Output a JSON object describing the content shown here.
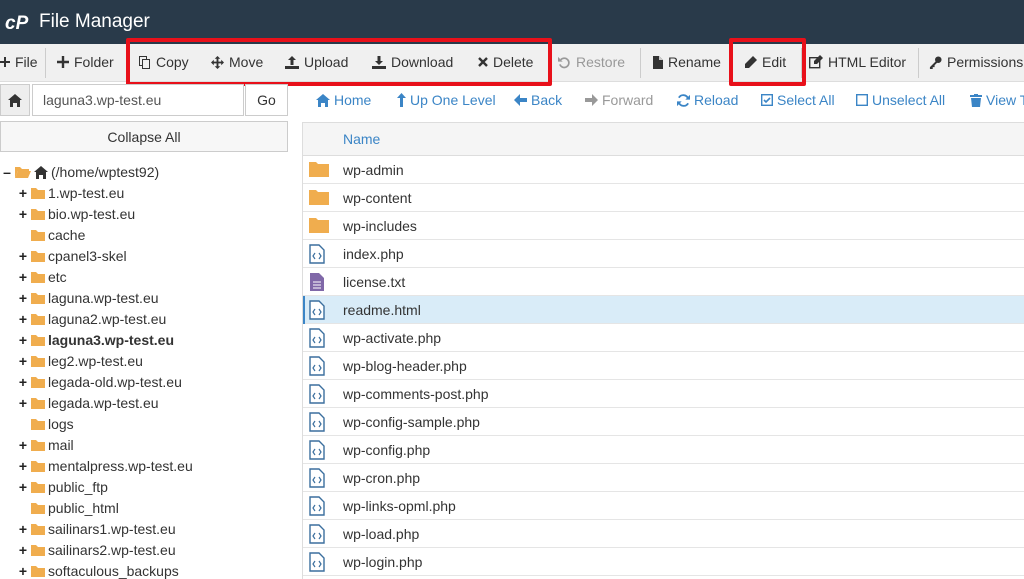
{
  "app": {
    "title": "File Manager",
    "logo_icon": "cpanel-logo-icon"
  },
  "toolbar": {
    "file": "File",
    "folder": "Folder",
    "copy": "Copy",
    "move": "Move",
    "upload": "Upload",
    "download": "Download",
    "delete": "Delete",
    "restore": "Restore",
    "rename": "Rename",
    "edit": "Edit",
    "html_editor": "HTML Editor",
    "permissions": "Permissions"
  },
  "path": {
    "value": "laguna3.wp-test.eu",
    "go": "Go"
  },
  "collapse_all": "Collapse All",
  "tree": [
    "(/home/wptest92)",
    "1.wp-test.eu",
    "bio.wp-test.eu",
    "cache",
    "cpanel3-skel",
    "etc",
    "laguna.wp-test.eu",
    "laguna2.wp-test.eu",
    "laguna3.wp-test.eu",
    "leg2.wp-test.eu",
    "legada-old.wp-test.eu",
    "legada.wp-test.eu",
    "logs",
    "mail",
    "mentalpress.wp-test.eu",
    "public_ftp",
    "public_html",
    "sailinars1.wp-test.eu",
    "sailinars2.wp-test.eu",
    "softaculous_backups"
  ],
  "nav": {
    "home": "Home",
    "up": "Up One Level",
    "back": "Back",
    "forward": "Forward",
    "reload": "Reload",
    "select_all": "Select All",
    "unselect_all": "Unselect All",
    "view_trash": "View T"
  },
  "table": {
    "name_header": "Name"
  },
  "files": [
    "wp-admin",
    "wp-content",
    "wp-includes",
    "index.php",
    "license.txt",
    "readme.html",
    "wp-activate.php",
    "wp-blog-header.php",
    "wp-comments-post.php",
    "wp-config-sample.php",
    "wp-config.php",
    "wp-cron.php",
    "wp-links-opml.php",
    "wp-load.php",
    "wp-login.php"
  ],
  "colors": {
    "titlebar": "#293a4a",
    "link": "#3b85c6",
    "folder": "#f0ad4e",
    "highlight": "#e8101a",
    "selected_row": "#d9ecf8"
  }
}
